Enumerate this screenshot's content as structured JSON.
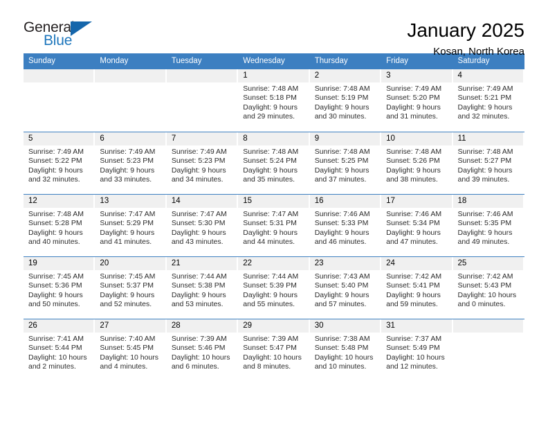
{
  "logo": {
    "word_one": "General",
    "word_two": "Blue",
    "triangle_color": "#1566ab"
  },
  "header": {
    "title": "January 2025",
    "subtitle": "Kosan, North Korea"
  },
  "theme": {
    "header_blue": "#3c7fc1",
    "day_band_gray": "#f0f0f0",
    "text_black": "#000000"
  },
  "calendar": {
    "weekdays": [
      "Sunday",
      "Monday",
      "Tuesday",
      "Wednesday",
      "Thursday",
      "Friday",
      "Saturday"
    ],
    "weeks": [
      [
        {
          "day": "",
          "sunrise": "",
          "sunset": "",
          "daylight_line1": "",
          "daylight_line2": ""
        },
        {
          "day": "",
          "sunrise": "",
          "sunset": "",
          "daylight_line1": "",
          "daylight_line2": ""
        },
        {
          "day": "",
          "sunrise": "",
          "sunset": "",
          "daylight_line1": "",
          "daylight_line2": ""
        },
        {
          "day": "1",
          "sunrise": "Sunrise: 7:48 AM",
          "sunset": "Sunset: 5:18 PM",
          "daylight_line1": "Daylight: 9 hours",
          "daylight_line2": "and 29 minutes."
        },
        {
          "day": "2",
          "sunrise": "Sunrise: 7:48 AM",
          "sunset": "Sunset: 5:19 PM",
          "daylight_line1": "Daylight: 9 hours",
          "daylight_line2": "and 30 minutes."
        },
        {
          "day": "3",
          "sunrise": "Sunrise: 7:49 AM",
          "sunset": "Sunset: 5:20 PM",
          "daylight_line1": "Daylight: 9 hours",
          "daylight_line2": "and 31 minutes."
        },
        {
          "day": "4",
          "sunrise": "Sunrise: 7:49 AM",
          "sunset": "Sunset: 5:21 PM",
          "daylight_line1": "Daylight: 9 hours",
          "daylight_line2": "and 32 minutes."
        }
      ],
      [
        {
          "day": "5",
          "sunrise": "Sunrise: 7:49 AM",
          "sunset": "Sunset: 5:22 PM",
          "daylight_line1": "Daylight: 9 hours",
          "daylight_line2": "and 32 minutes."
        },
        {
          "day": "6",
          "sunrise": "Sunrise: 7:49 AM",
          "sunset": "Sunset: 5:23 PM",
          "daylight_line1": "Daylight: 9 hours",
          "daylight_line2": "and 33 minutes."
        },
        {
          "day": "7",
          "sunrise": "Sunrise: 7:49 AM",
          "sunset": "Sunset: 5:23 PM",
          "daylight_line1": "Daylight: 9 hours",
          "daylight_line2": "and 34 minutes."
        },
        {
          "day": "8",
          "sunrise": "Sunrise: 7:48 AM",
          "sunset": "Sunset: 5:24 PM",
          "daylight_line1": "Daylight: 9 hours",
          "daylight_line2": "and 35 minutes."
        },
        {
          "day": "9",
          "sunrise": "Sunrise: 7:48 AM",
          "sunset": "Sunset: 5:25 PM",
          "daylight_line1": "Daylight: 9 hours",
          "daylight_line2": "and 37 minutes."
        },
        {
          "day": "10",
          "sunrise": "Sunrise: 7:48 AM",
          "sunset": "Sunset: 5:26 PM",
          "daylight_line1": "Daylight: 9 hours",
          "daylight_line2": "and 38 minutes."
        },
        {
          "day": "11",
          "sunrise": "Sunrise: 7:48 AM",
          "sunset": "Sunset: 5:27 PM",
          "daylight_line1": "Daylight: 9 hours",
          "daylight_line2": "and 39 minutes."
        }
      ],
      [
        {
          "day": "12",
          "sunrise": "Sunrise: 7:48 AM",
          "sunset": "Sunset: 5:28 PM",
          "daylight_line1": "Daylight: 9 hours",
          "daylight_line2": "and 40 minutes."
        },
        {
          "day": "13",
          "sunrise": "Sunrise: 7:47 AM",
          "sunset": "Sunset: 5:29 PM",
          "daylight_line1": "Daylight: 9 hours",
          "daylight_line2": "and 41 minutes."
        },
        {
          "day": "14",
          "sunrise": "Sunrise: 7:47 AM",
          "sunset": "Sunset: 5:30 PM",
          "daylight_line1": "Daylight: 9 hours",
          "daylight_line2": "and 43 minutes."
        },
        {
          "day": "15",
          "sunrise": "Sunrise: 7:47 AM",
          "sunset": "Sunset: 5:31 PM",
          "daylight_line1": "Daylight: 9 hours",
          "daylight_line2": "and 44 minutes."
        },
        {
          "day": "16",
          "sunrise": "Sunrise: 7:46 AM",
          "sunset": "Sunset: 5:33 PM",
          "daylight_line1": "Daylight: 9 hours",
          "daylight_line2": "and 46 minutes."
        },
        {
          "day": "17",
          "sunrise": "Sunrise: 7:46 AM",
          "sunset": "Sunset: 5:34 PM",
          "daylight_line1": "Daylight: 9 hours",
          "daylight_line2": "and 47 minutes."
        },
        {
          "day": "18",
          "sunrise": "Sunrise: 7:46 AM",
          "sunset": "Sunset: 5:35 PM",
          "daylight_line1": "Daylight: 9 hours",
          "daylight_line2": "and 49 minutes."
        }
      ],
      [
        {
          "day": "19",
          "sunrise": "Sunrise: 7:45 AM",
          "sunset": "Sunset: 5:36 PM",
          "daylight_line1": "Daylight: 9 hours",
          "daylight_line2": "and 50 minutes."
        },
        {
          "day": "20",
          "sunrise": "Sunrise: 7:45 AM",
          "sunset": "Sunset: 5:37 PM",
          "daylight_line1": "Daylight: 9 hours",
          "daylight_line2": "and 52 minutes."
        },
        {
          "day": "21",
          "sunrise": "Sunrise: 7:44 AM",
          "sunset": "Sunset: 5:38 PM",
          "daylight_line1": "Daylight: 9 hours",
          "daylight_line2": "and 53 minutes."
        },
        {
          "day": "22",
          "sunrise": "Sunrise: 7:44 AM",
          "sunset": "Sunset: 5:39 PM",
          "daylight_line1": "Daylight: 9 hours",
          "daylight_line2": "and 55 minutes."
        },
        {
          "day": "23",
          "sunrise": "Sunrise: 7:43 AM",
          "sunset": "Sunset: 5:40 PM",
          "daylight_line1": "Daylight: 9 hours",
          "daylight_line2": "and 57 minutes."
        },
        {
          "day": "24",
          "sunrise": "Sunrise: 7:42 AM",
          "sunset": "Sunset: 5:41 PM",
          "daylight_line1": "Daylight: 9 hours",
          "daylight_line2": "and 59 minutes."
        },
        {
          "day": "25",
          "sunrise": "Sunrise: 7:42 AM",
          "sunset": "Sunset: 5:43 PM",
          "daylight_line1": "Daylight: 10 hours",
          "daylight_line2": "and 0 minutes."
        }
      ],
      [
        {
          "day": "26",
          "sunrise": "Sunrise: 7:41 AM",
          "sunset": "Sunset: 5:44 PM",
          "daylight_line1": "Daylight: 10 hours",
          "daylight_line2": "and 2 minutes."
        },
        {
          "day": "27",
          "sunrise": "Sunrise: 7:40 AM",
          "sunset": "Sunset: 5:45 PM",
          "daylight_line1": "Daylight: 10 hours",
          "daylight_line2": "and 4 minutes."
        },
        {
          "day": "28",
          "sunrise": "Sunrise: 7:39 AM",
          "sunset": "Sunset: 5:46 PM",
          "daylight_line1": "Daylight: 10 hours",
          "daylight_line2": "and 6 minutes."
        },
        {
          "day": "29",
          "sunrise": "Sunrise: 7:39 AM",
          "sunset": "Sunset: 5:47 PM",
          "daylight_line1": "Daylight: 10 hours",
          "daylight_line2": "and 8 minutes."
        },
        {
          "day": "30",
          "sunrise": "Sunrise: 7:38 AM",
          "sunset": "Sunset: 5:48 PM",
          "daylight_line1": "Daylight: 10 hours",
          "daylight_line2": "and 10 minutes."
        },
        {
          "day": "31",
          "sunrise": "Sunrise: 7:37 AM",
          "sunset": "Sunset: 5:49 PM",
          "daylight_line1": "Daylight: 10 hours",
          "daylight_line2": "and 12 minutes."
        },
        {
          "day": "",
          "sunrise": "",
          "sunset": "",
          "daylight_line1": "",
          "daylight_line2": ""
        }
      ]
    ]
  }
}
